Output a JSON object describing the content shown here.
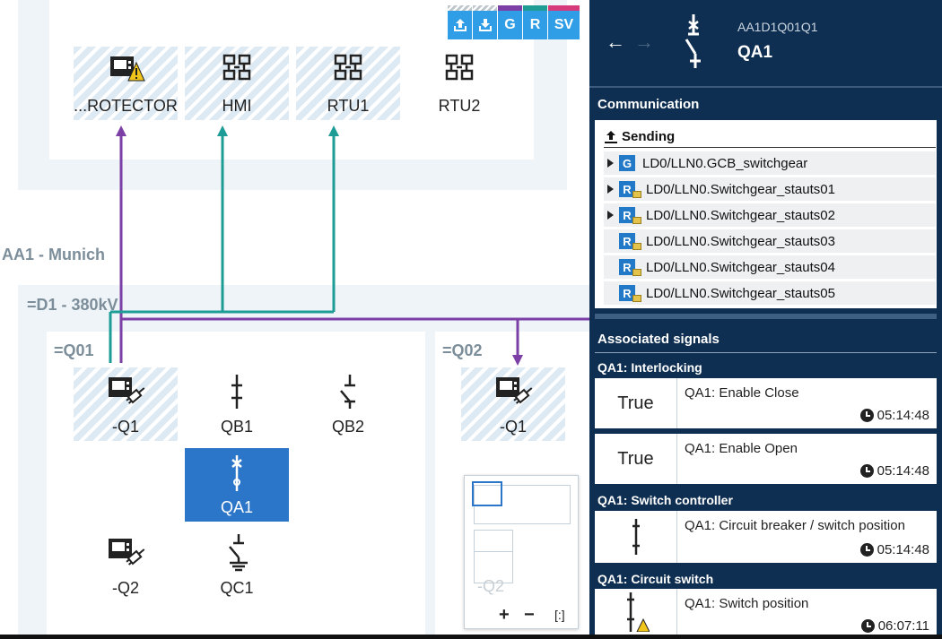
{
  "toolbar": {
    "buttons": [
      {
        "id": "upload",
        "label": ""
      },
      {
        "id": "download",
        "label": ""
      },
      {
        "id": "goose",
        "label": "G",
        "color": "#7b3fa6"
      },
      {
        "id": "report",
        "label": "R",
        "color": "#1e9c96"
      },
      {
        "id": "sv",
        "label": "SV",
        "color": "#d63a7a"
      }
    ]
  },
  "diagram": {
    "top_nodes": [
      {
        "label": "...ROTECTOR",
        "icon": "protection-device-warning-icon"
      },
      {
        "label": "HMI",
        "icon": "network-icon"
      },
      {
        "label": "RTU1",
        "icon": "network-icon"
      },
      {
        "label": "RTU2",
        "icon": "network-icon"
      }
    ],
    "substation_label": "AA1 - Munich",
    "voltage_label": "=D1 - 380kV",
    "bay1_label": "=Q01",
    "bay2_label": "=Q02",
    "bay1_nodes": [
      {
        "label": "-Q1",
        "icon": "ied-plug-icon"
      },
      {
        "label": "QB1",
        "icon": "disconnector-icon"
      },
      {
        "label": "QB2",
        "icon": "disconnector-open-icon"
      },
      {
        "label": "QA1",
        "icon": "circuit-breaker-icon",
        "selected": true
      },
      {
        "label": "-Q2",
        "icon": "ied-plug-icon"
      },
      {
        "label": "QC1",
        "icon": "earthing-switch-icon"
      }
    ],
    "bay2_nodes": [
      {
        "label": "-Q1",
        "icon": "ied-plug-icon"
      }
    ],
    "minimap": {
      "ghost_label": "-Q2",
      "zoom_in": "+",
      "zoom_out": "−",
      "fit": "[:]"
    },
    "colors": {
      "goose": "#7b3fa6",
      "report": "#1e9c96",
      "selected": "#2b76c8"
    }
  },
  "panel": {
    "nav_back": "←",
    "nav_forward": "→",
    "object_path": "AA1D1Q01Q1",
    "object_name": "QA1",
    "communication_title": "Communication",
    "sending_label": "Sending",
    "comm_items": [
      {
        "type": "G",
        "label": "LD0/LLN0.GCB_switchgear",
        "expandable": true
      },
      {
        "type": "R",
        "label": "LD0/LLN0.Switchgear_stauts01",
        "expandable": true
      },
      {
        "type": "R",
        "label": "LD0/LLN0.Switchgear_stauts02",
        "expandable": true
      },
      {
        "type": "R",
        "label": "LD0/LLN0.Switchgear_stauts03",
        "expandable": false
      },
      {
        "type": "R",
        "label": "LD0/LLN0.Switchgear_stauts04",
        "expandable": false
      },
      {
        "type": "R",
        "label": "LD0/LLN0.Switchgear_stauts05",
        "expandable": false
      }
    ],
    "associated_title": "Associated signals",
    "groups": [
      {
        "title": "QA1: Interlocking",
        "signals": [
          {
            "value": "True",
            "name": "QA1: Enable Close",
            "time": "05:14:48"
          },
          {
            "value": "True",
            "name": "QA1: Enable Open",
            "time": "05:14:48"
          }
        ]
      },
      {
        "title": "QA1: Switch controller",
        "signals": [
          {
            "value": "",
            "name": "QA1: Circuit breaker / switch position",
            "time": "05:14:48"
          }
        ]
      },
      {
        "title": "QA1: Circuit switch",
        "signals": [
          {
            "value": "",
            "name": "QA1: Switch position",
            "time": "06:07:11"
          }
        ]
      }
    ]
  }
}
